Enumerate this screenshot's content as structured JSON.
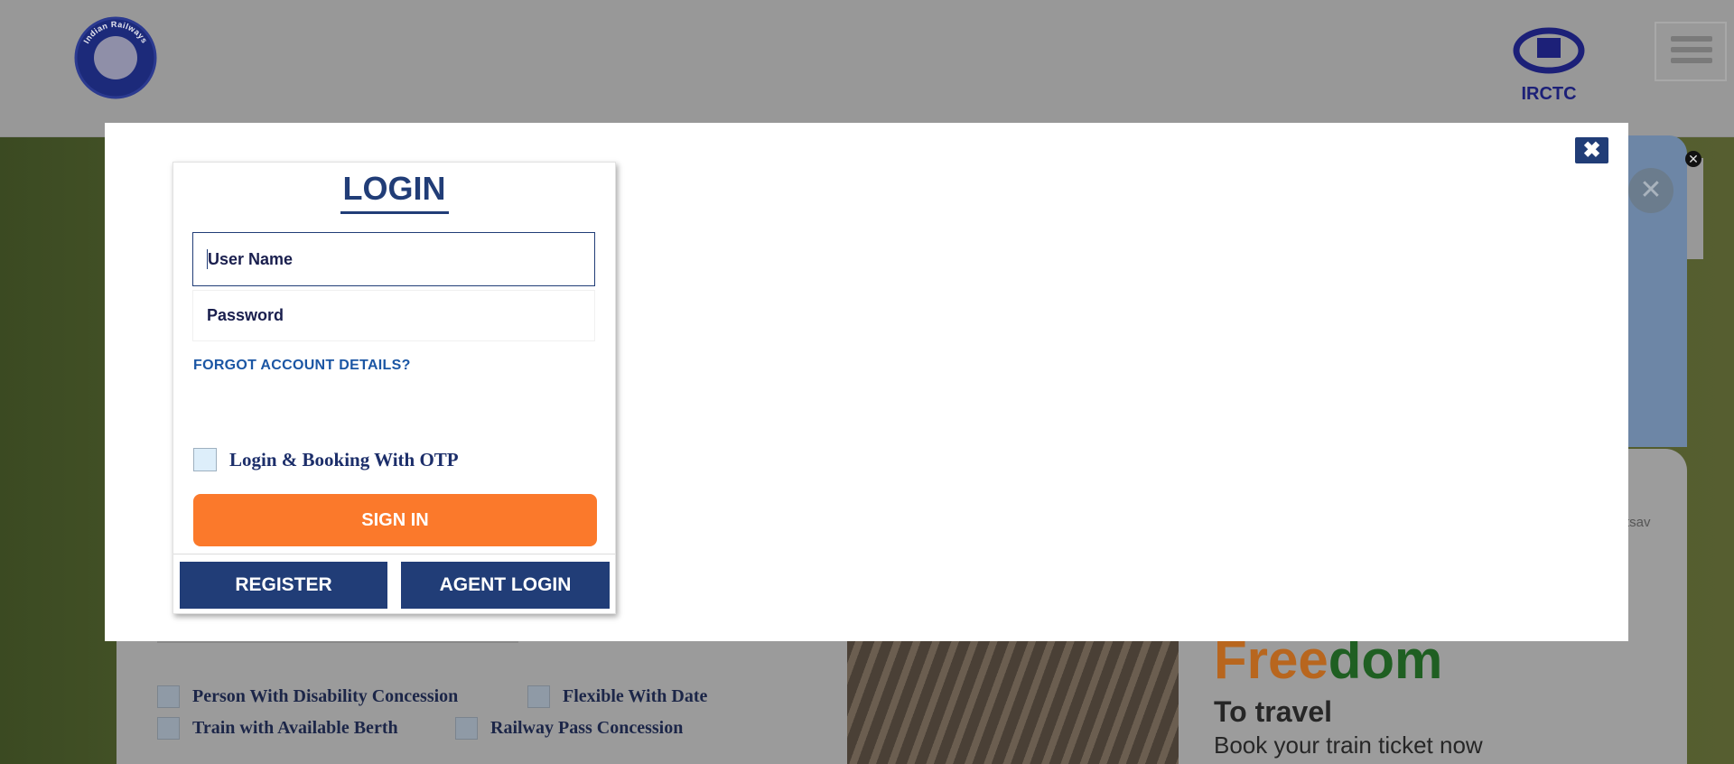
{
  "header": {
    "brand_left": "Indian Railways",
    "brand_right": "IRCTC"
  },
  "login": {
    "title": "LOGIN",
    "username_placeholder": "User Name",
    "password_placeholder": "Password",
    "forgot_link": "FORGOT ACCOUNT DETAILS?",
    "otp_label": "Login & Booking With OTP",
    "sign_in": "SIGN IN",
    "register": "REGISTER",
    "agent_login": "AGENT LOGIN"
  },
  "background": {
    "options": [
      "Person With Disability Concession",
      "Flexible With Date",
      "Train with Available Berth",
      "Railway Pass Concession"
    ],
    "promo": {
      "free": "Free",
      "dom": "dom",
      "to_travel": "To travel",
      "book": "Book your train ticket now",
      "utsav": "tsav"
    }
  },
  "colors": {
    "primary": "#213d77",
    "accent": "#fb792b"
  }
}
